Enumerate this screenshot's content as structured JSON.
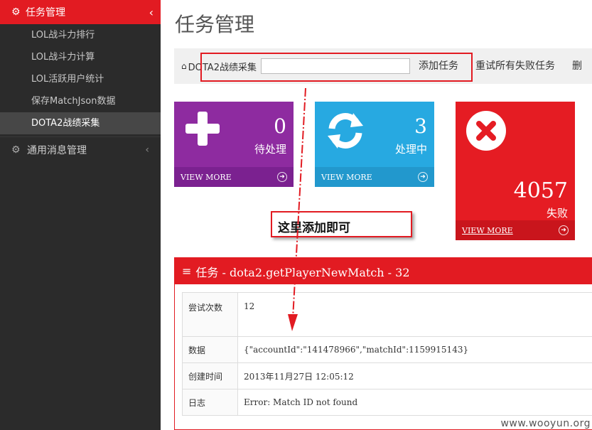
{
  "sidebar": {
    "group1": {
      "label": "任务管理",
      "icon": "gears-icon"
    },
    "items": [
      {
        "label": "LOL战斗力排行"
      },
      {
        "label": "LOL战斗力计算"
      },
      {
        "label": "LOL活跃用户统计"
      },
      {
        "label": "保存MatchJson数据"
      },
      {
        "label": "DOTA2战绩采集",
        "active": true
      }
    ],
    "group2": {
      "label": "通用消息管理",
      "icon": "gears-icon"
    }
  },
  "page": {
    "title": "任务管理"
  },
  "toolbar": {
    "breadcrumb": "DOTA2战绩采集",
    "input_value": "",
    "add_label": "添加任务",
    "retry_label": "重试所有失败任务",
    "more_label": "删"
  },
  "cards": [
    {
      "count": "0",
      "label": "待处理",
      "footer": "VIEW MORE",
      "color": "#8e2ba0",
      "icon": "plus-icon"
    },
    {
      "count": "3",
      "label": "处理中",
      "footer": "VIEW MORE",
      "color": "#27a9e1",
      "icon": "refresh-icon"
    },
    {
      "count": "4057",
      "label": "失败",
      "footer": "VIEW MORE",
      "color": "#e51c23",
      "icon": "close-circle-icon"
    }
  ],
  "annotation": {
    "text": "这里添加即可"
  },
  "panel": {
    "title": "任务 - dota2.getPlayerNewMatch - 32",
    "rows": [
      {
        "key": "尝试次数",
        "value": "12"
      },
      {
        "key": "数据",
        "value": "{\"accountId\":\"141478966\",\"matchId\":1159915143}"
      },
      {
        "key": "创建时间",
        "value": "2013年11月27日 12:05:12"
      },
      {
        "key": "日志",
        "value": "Error: Match ID not found"
      }
    ]
  },
  "watermark": "www.wooyun.org",
  "colors": {
    "accent": "#e21b22",
    "sidebar_bg": "#2b2b2b"
  }
}
